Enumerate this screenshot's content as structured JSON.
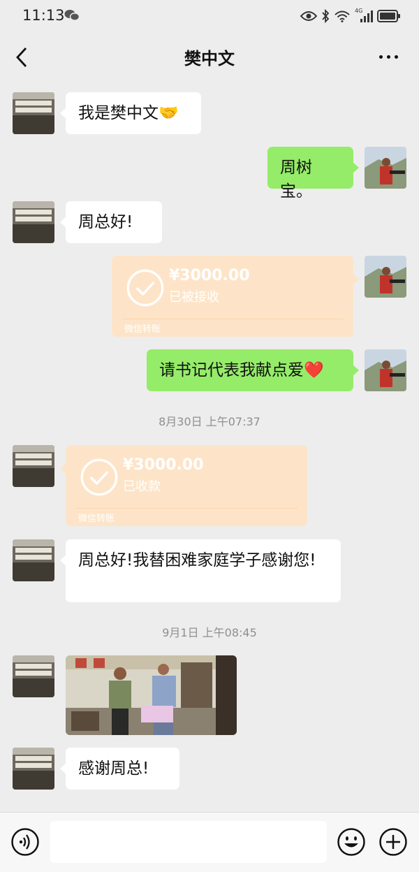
{
  "status_bar": {
    "time": "11:13",
    "network": "4G"
  },
  "header": {
    "title": "樊中文"
  },
  "messages": {
    "m1": "我是樊中文🤝",
    "m2": "周树宝。",
    "m3": "周总好!",
    "t1": {
      "amount": "¥3000.00",
      "status": "已被接收",
      "label": "微信转账"
    },
    "m5": "请书记代表我献点爱❤️",
    "ts1": "8月30日 上午07:37",
    "t2": {
      "amount": "¥3000.00",
      "status": "已收款",
      "label": "微信转账"
    },
    "m7": "周总好!我替困难家庭学子感谢您!",
    "ts2": "9月1日 上午08:45",
    "m9": "感谢周总!"
  },
  "composer": {
    "input_value": ""
  },
  "colors": {
    "bubble_green": "#95ec69",
    "transfer_bg": "#fde4c8",
    "background": "#ededed"
  },
  "icons": [
    "wechat-icon",
    "eye-icon",
    "bluetooth-icon",
    "wifi-icon",
    "signal-icon",
    "battery-icon",
    "back-arrow-icon",
    "more-icon",
    "transfer-check-icon",
    "voice-icon",
    "emoji-icon",
    "plus-icon"
  ]
}
